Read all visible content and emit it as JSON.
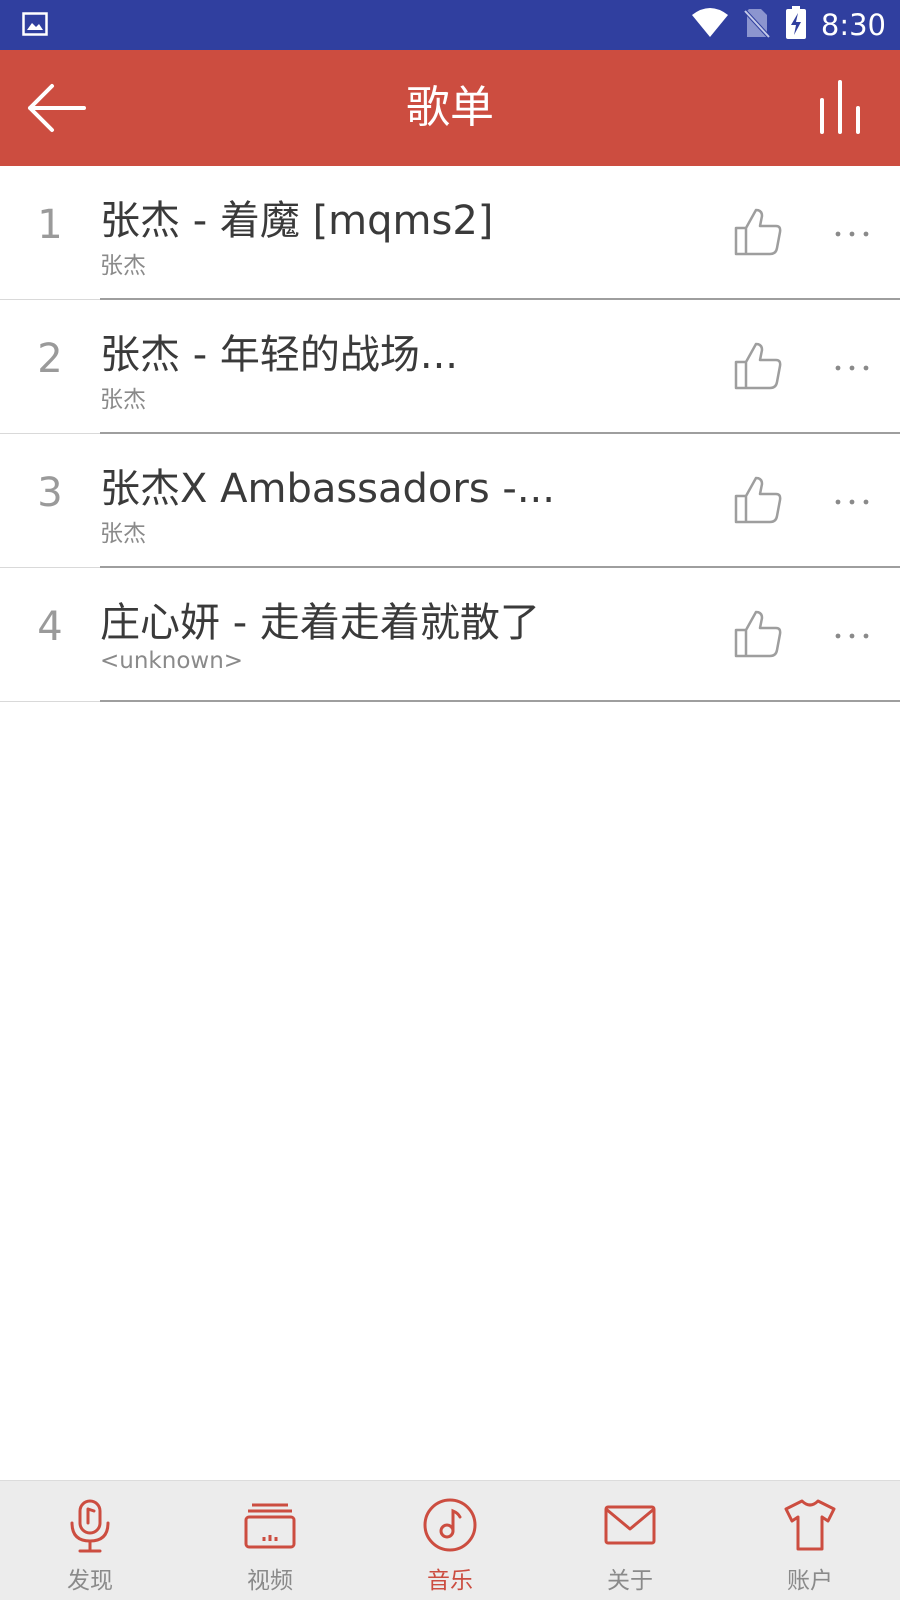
{
  "status_bar": {
    "time": "8:30",
    "icons": [
      "image-notification-icon",
      "wifi-icon",
      "no-sim-icon",
      "battery-charging-icon"
    ]
  },
  "app_bar": {
    "title": "歌单",
    "back_icon": "back-arrow-icon",
    "equalizer_icon": "equalizer-icon"
  },
  "songs": [
    {
      "index": "1",
      "title": "张杰 - 着魔 [mqms2]",
      "artist": "张杰"
    },
    {
      "index": "2",
      "title": "张杰 - 年轻的战场...",
      "artist": "张杰"
    },
    {
      "index": "3",
      "title": "张杰X Ambassadors -...",
      "artist": "张杰"
    },
    {
      "index": "4",
      "title": "庄心妍 - 走着走着就散了",
      "artist": "<unknown>"
    }
  ],
  "bottom_nav": {
    "items": [
      {
        "label": "发现",
        "icon": "microphone-icon",
        "active": false
      },
      {
        "label": "视频",
        "icon": "video-icon",
        "active": false
      },
      {
        "label": "音乐",
        "icon": "music-icon",
        "active": true
      },
      {
        "label": "关于",
        "icon": "mail-icon",
        "active": false
      },
      {
        "label": "账户",
        "icon": "shirt-icon",
        "active": false
      }
    ]
  },
  "colors": {
    "status_bar": "#303F9F",
    "app_bar": "#CC4D40",
    "accent": "#CC4D40",
    "nav_background": "#ECECEC"
  }
}
